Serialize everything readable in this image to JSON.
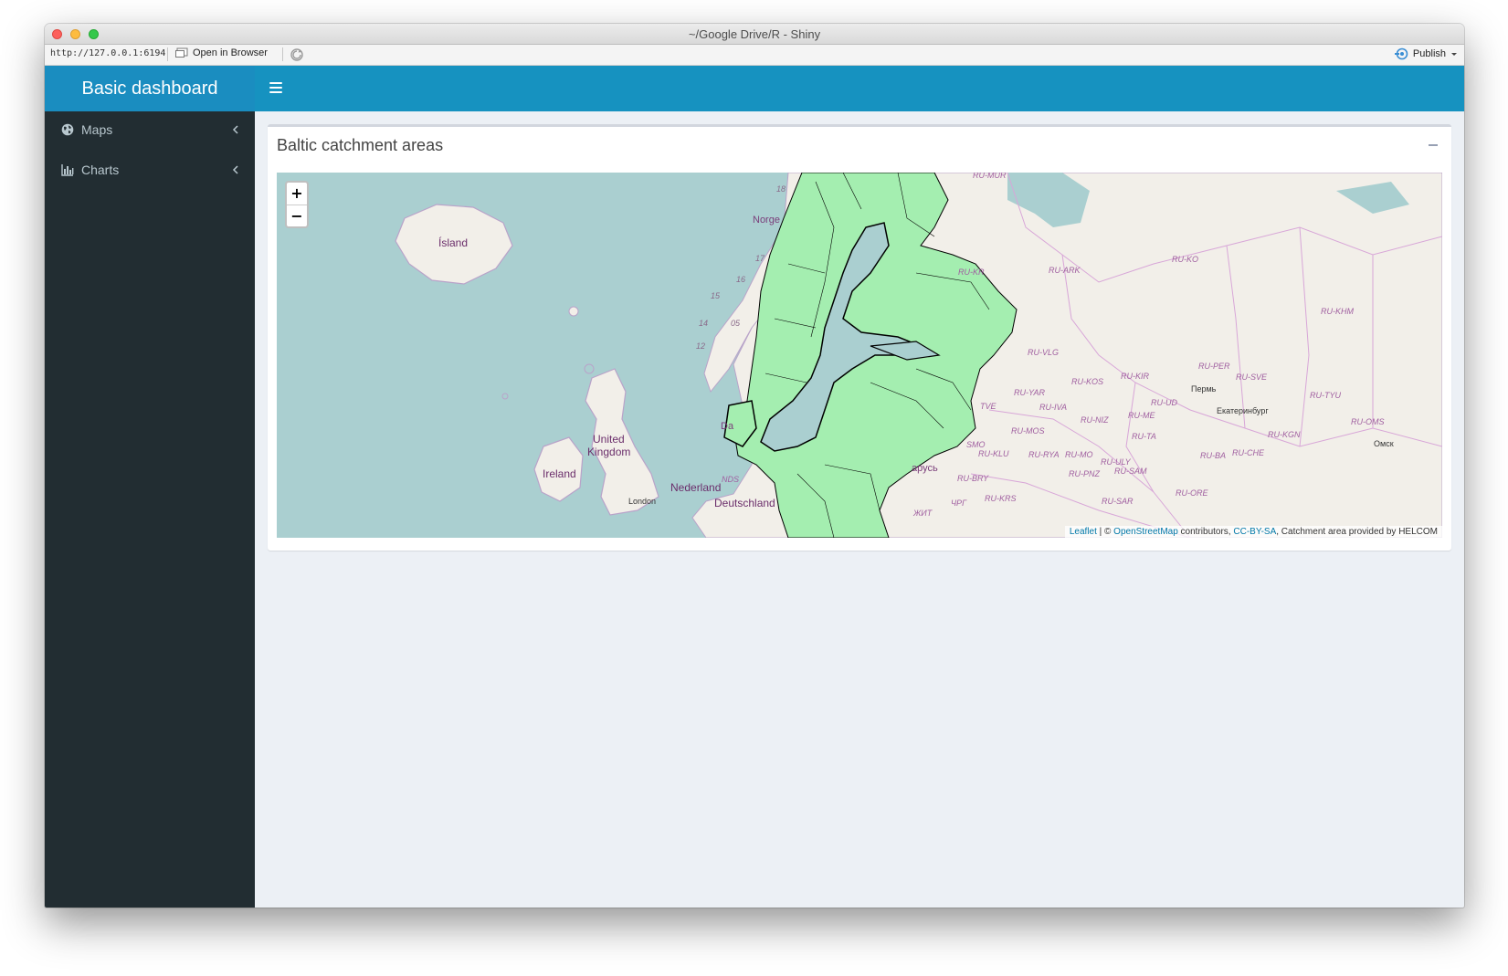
{
  "window": {
    "title": "~/Google Drive/R - Shiny",
    "url": "http://127.0.0.1:6194",
    "open_in_browser": "Open in Browser",
    "publish": "Publish"
  },
  "header": {
    "brand": "Basic dashboard"
  },
  "sidebar": {
    "items": [
      {
        "label": "Maps",
        "icon": "globe-icon"
      },
      {
        "label": "Charts",
        "icon": "bar-chart-icon"
      }
    ]
  },
  "box": {
    "title": "Baltic catchment areas"
  },
  "map": {
    "zoom_in": "+",
    "zoom_out": "−",
    "attribution": {
      "leaflet": "Leaflet",
      "sep1": " | © ",
      "osm": "OpenStreetMap",
      "contributors": " contributors, ",
      "license": "CC-BY-SA",
      "helcom": ", Catchment area provided by HELCOM"
    },
    "labels": {
      "island": "Ísland",
      "norge": "Norge",
      "uk1": "United",
      "uk2": "Kingdom",
      "ireland": "Ireland",
      "london": "London",
      "nederland": "Nederland",
      "deutschland": "Deutschland",
      "nds": "NDS",
      "danmark": "Da",
      "belarus": "арусь",
      "zhyt": "ЖИТ",
      "chrg": "ЧРГ",
      "perm": "Пермь",
      "ekat": "Екатеринбург",
      "omsk": "Омск",
      "ru_mur": "RU-MUR",
      "ru_kr": "RU-KR",
      "ru_ark": "RU-ARK",
      "ru_ko": "RU-KO",
      "ru_khm": "RU-KHM",
      "ru_vlg": "RU-VLG",
      "ru_per": "RU-PER",
      "ru_sve": "RU-SVE",
      "ru_kir": "RU-KIR",
      "ru_kos": "RU-KOS",
      "ru_yar": "RU-YAR",
      "ru_tyu": "RU-TYU",
      "ru_iva": "RU-IVA",
      "ru_ud": "RU-UD",
      "tve": "TVE",
      "ru_niz": "RU-NIZ",
      "ru_me": "RU-ME",
      "ru_mos": "RU-MOS",
      "ru_ta": "RU-TA",
      "ru_kgn": "RU-KGN",
      "ru_oms": "RU-OMS",
      "smo": "SMO",
      "ru_klu": "RU-KLU",
      "ru_rya": "RU-RYA",
      "ru_mo": "RU-MO",
      "ru_ba": "RU-BA",
      "ru_che": "RU-CHE",
      "ru_uly": "RU-ULY",
      "ru_bry": "RU-BRY",
      "ru_pnz": "RU-PNZ",
      "ru_sam": "RU-SAM",
      "ru_ore": "RU-ORE",
      "ru_krs": "RU-KRS",
      "ru_sar": "RU-SAR",
      "n18": "18",
      "n17": "17",
      "n16": "16",
      "n15": "15",
      "n14": "14",
      "n05": "05",
      "n12": "12"
    }
  }
}
